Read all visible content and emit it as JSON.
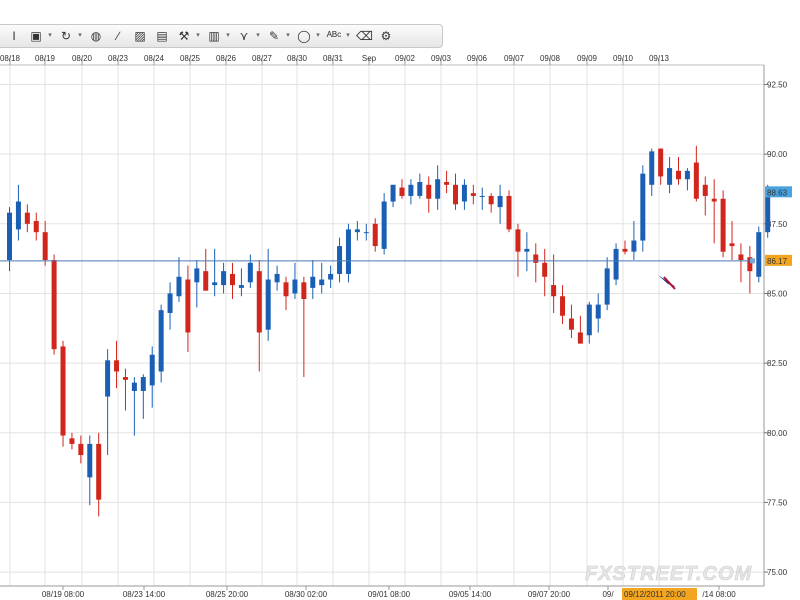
{
  "toolbar": {
    "icons": [
      {
        "name": "cursor-tool-icon",
        "glyph": "Ι",
        "dropdown": false
      },
      {
        "name": "chart-properties-icon",
        "glyph": "▣",
        "dropdown": true
      },
      {
        "name": "refresh-icon",
        "glyph": "↻",
        "dropdown": true
      },
      {
        "name": "globe-icon",
        "glyph": "◍",
        "dropdown": false
      },
      {
        "name": "ruler-icon",
        "glyph": "∕",
        "dropdown": false
      },
      {
        "name": "picture-icon",
        "glyph": "▨",
        "dropdown": false
      },
      {
        "name": "chart-type-icon",
        "glyph": "▤",
        "dropdown": false
      },
      {
        "name": "fibonacci-icon",
        "glyph": "⚒",
        "dropdown": true
      },
      {
        "name": "channel-icon",
        "glyph": "▥",
        "dropdown": true
      },
      {
        "name": "gann-icon",
        "glyph": "⋎",
        "dropdown": true
      },
      {
        "name": "pencil-icon",
        "glyph": "✎",
        "dropdown": true
      },
      {
        "name": "ellipse-icon",
        "glyph": "◯",
        "dropdown": true
      },
      {
        "name": "text-tool-icon",
        "glyph": "ᴬᴮᶜ",
        "dropdown": true
      },
      {
        "name": "eraser-icon",
        "glyph": "⌫",
        "dropdown": false
      },
      {
        "name": "settings-icon",
        "glyph": "⚙",
        "dropdown": false
      }
    ]
  },
  "chart_data": {
    "type": "candlestick",
    "top_date_labels": [
      "08/18",
      "08/19",
      "08/20",
      "08/23",
      "08/24",
      "08/25",
      "08/26",
      "08/27",
      "08/30",
      "08/31",
      "Sep",
      "09/02",
      "09/03",
      "09/06",
      "09/07",
      "09/08",
      "09/09",
      "09/10",
      "09/13"
    ],
    "bottom_time_labels": [
      "08/19 08:00",
      "08/23 14:00",
      "08/25 20:00",
      "08/30 02:00",
      "09/01 08:00",
      "09/05 14:00",
      "09/07 20:00",
      "09/",
      "09/12/2011 20:00",
      "/14 08:00"
    ],
    "y_ticks": [
      "92.50",
      "90.00",
      "87.50",
      "85.00",
      "82.50",
      "80.00",
      "77.50",
      "75.00"
    ],
    "ylim": [
      74.5,
      93.2
    ],
    "current_price": "86.17",
    "last_price": "88.63",
    "horizontal_line": 86.17,
    "cursor_time_label": "09/12/2011 20:00",
    "watermark": "FXSTREET.COM",
    "colors": {
      "up": "#1a5fb4",
      "down": "#d0261c",
      "price_line": "#4a78b5",
      "grid": "#e3e3e3",
      "current_bg": "#f3a51f",
      "last_bg": "#4aa3df"
    },
    "candles": [
      {
        "o": 86.2,
        "h": 88.1,
        "l": 85.8,
        "c": 87.9
      },
      {
        "o": 87.3,
        "h": 88.9,
        "l": 86.9,
        "c": 88.3
      },
      {
        "o": 87.9,
        "h": 88.2,
        "l": 87.2,
        "c": 87.5
      },
      {
        "o": 87.6,
        "h": 87.9,
        "l": 86.9,
        "c": 87.2
      },
      {
        "o": 87.2,
        "h": 87.6,
        "l": 86.0,
        "c": 86.2
      },
      {
        "o": 86.2,
        "h": 86.4,
        "l": 82.8,
        "c": 83.0
      },
      {
        "o": 83.1,
        "h": 83.3,
        "l": 79.5,
        "c": 79.9
      },
      {
        "o": 79.8,
        "h": 80.0,
        "l": 79.4,
        "c": 79.6
      },
      {
        "o": 79.6,
        "h": 79.9,
        "l": 78.9,
        "c": 79.2
      },
      {
        "o": 78.4,
        "h": 79.9,
        "l": 77.4,
        "c": 79.6
      },
      {
        "o": 79.6,
        "h": 80.0,
        "l": 77.0,
        "c": 77.6
      },
      {
        "o": 81.3,
        "h": 83.0,
        "l": 79.2,
        "c": 82.6
      },
      {
        "o": 82.6,
        "h": 83.3,
        "l": 81.6,
        "c": 82.2
      },
      {
        "o": 82.0,
        "h": 82.3,
        "l": 80.8,
        "c": 81.9
      },
      {
        "o": 81.5,
        "h": 82.0,
        "l": 79.9,
        "c": 81.8
      },
      {
        "o": 81.5,
        "h": 82.1,
        "l": 80.5,
        "c": 82.0
      },
      {
        "o": 81.7,
        "h": 83.1,
        "l": 80.9,
        "c": 82.8
      },
      {
        "o": 82.2,
        "h": 84.6,
        "l": 81.8,
        "c": 84.4
      },
      {
        "o": 84.3,
        "h": 85.4,
        "l": 83.7,
        "c": 85.0
      },
      {
        "o": 84.9,
        "h": 86.3,
        "l": 84.7,
        "c": 85.6
      },
      {
        "o": 85.5,
        "h": 86.0,
        "l": 82.9,
        "c": 83.6
      },
      {
        "o": 85.4,
        "h": 86.2,
        "l": 84.5,
        "c": 85.9
      },
      {
        "o": 85.8,
        "h": 86.6,
        "l": 85.3,
        "c": 85.1
      },
      {
        "o": 85.3,
        "h": 86.6,
        "l": 84.9,
        "c": 85.4
      },
      {
        "o": 85.3,
        "h": 86.1,
        "l": 85.0,
        "c": 85.8
      },
      {
        "o": 85.7,
        "h": 86.1,
        "l": 84.8,
        "c": 85.3
      },
      {
        "o": 85.2,
        "h": 85.9,
        "l": 84.9,
        "c": 85.3
      },
      {
        "o": 85.4,
        "h": 86.4,
        "l": 85.2,
        "c": 86.1
      },
      {
        "o": 85.8,
        "h": 86.2,
        "l": 82.2,
        "c": 83.6
      },
      {
        "o": 83.7,
        "h": 86.6,
        "l": 83.3,
        "c": 85.5
      },
      {
        "o": 85.4,
        "h": 86.0,
        "l": 85.1,
        "c": 85.7
      },
      {
        "o": 85.4,
        "h": 85.6,
        "l": 84.4,
        "c": 84.9
      },
      {
        "o": 85.0,
        "h": 86.1,
        "l": 84.8,
        "c": 85.5
      },
      {
        "o": 85.4,
        "h": 85.6,
        "l": 82.0,
        "c": 84.8
      },
      {
        "o": 85.2,
        "h": 86.2,
        "l": 84.8,
        "c": 85.6
      },
      {
        "o": 85.3,
        "h": 86.1,
        "l": 85.0,
        "c": 85.5
      },
      {
        "o": 85.5,
        "h": 86.0,
        "l": 85.2,
        "c": 85.7
      },
      {
        "o": 85.7,
        "h": 87.0,
        "l": 85.4,
        "c": 86.7
      },
      {
        "o": 85.7,
        "h": 87.5,
        "l": 85.4,
        "c": 87.3
      },
      {
        "o": 87.2,
        "h": 87.6,
        "l": 86.9,
        "c": 87.3
      },
      {
        "o": 87.2,
        "h": 87.5,
        "l": 86.9,
        "c": 87.2
      },
      {
        "o": 87.5,
        "h": 87.7,
        "l": 86.5,
        "c": 86.7
      },
      {
        "o": 86.6,
        "h": 88.6,
        "l": 86.4,
        "c": 88.3
      },
      {
        "o": 88.3,
        "h": 88.9,
        "l": 88.1,
        "c": 88.9
      },
      {
        "o": 88.8,
        "h": 89.1,
        "l": 88.4,
        "c": 88.5
      },
      {
        "o": 88.5,
        "h": 89.1,
        "l": 88.2,
        "c": 88.9
      },
      {
        "o": 88.5,
        "h": 89.3,
        "l": 88.4,
        "c": 89.0
      },
      {
        "o": 88.9,
        "h": 89.2,
        "l": 87.9,
        "c": 88.4
      },
      {
        "o": 88.4,
        "h": 89.6,
        "l": 88.0,
        "c": 89.1
      },
      {
        "o": 89.0,
        "h": 89.4,
        "l": 88.6,
        "c": 88.9
      },
      {
        "o": 88.9,
        "h": 89.3,
        "l": 88.0,
        "c": 88.2
      },
      {
        "o": 88.3,
        "h": 89.1,
        "l": 88.0,
        "c": 88.9
      },
      {
        "o": 88.6,
        "h": 88.9,
        "l": 88.2,
        "c": 88.5
      },
      {
        "o": 88.5,
        "h": 88.8,
        "l": 88.0,
        "c": 88.5
      },
      {
        "o": 88.5,
        "h": 88.6,
        "l": 87.9,
        "c": 88.2
      },
      {
        "o": 88.1,
        "h": 88.9,
        "l": 87.5,
        "c": 88.5
      },
      {
        "o": 88.5,
        "h": 88.7,
        "l": 87.2,
        "c": 87.3
      },
      {
        "o": 87.3,
        "h": 87.5,
        "l": 85.6,
        "c": 86.5
      },
      {
        "o": 86.5,
        "h": 87.2,
        "l": 85.8,
        "c": 86.6
      },
      {
        "o": 86.4,
        "h": 86.8,
        "l": 85.4,
        "c": 86.1
      },
      {
        "o": 86.1,
        "h": 86.6,
        "l": 84.9,
        "c": 85.6
      },
      {
        "o": 85.3,
        "h": 86.4,
        "l": 84.3,
        "c": 84.9
      },
      {
        "o": 84.9,
        "h": 85.3,
        "l": 83.9,
        "c": 84.2
      },
      {
        "o": 84.1,
        "h": 84.6,
        "l": 83.4,
        "c": 83.7
      },
      {
        "o": 83.6,
        "h": 84.2,
        "l": 83.2,
        "c": 83.2
      },
      {
        "o": 83.5,
        "h": 84.7,
        "l": 83.2,
        "c": 84.6
      },
      {
        "o": 84.1,
        "h": 85.0,
        "l": 83.6,
        "c": 84.6
      },
      {
        "o": 84.6,
        "h": 86.3,
        "l": 84.4,
        "c": 85.9
      },
      {
        "o": 85.5,
        "h": 86.8,
        "l": 85.3,
        "c": 86.6
      },
      {
        "o": 86.6,
        "h": 86.9,
        "l": 86.4,
        "c": 86.5
      },
      {
        "o": 86.5,
        "h": 87.6,
        "l": 86.2,
        "c": 86.9
      },
      {
        "o": 86.9,
        "h": 89.6,
        "l": 86.5,
        "c": 89.3
      },
      {
        "o": 88.9,
        "h": 90.2,
        "l": 88.5,
        "c": 90.1
      },
      {
        "o": 90.2,
        "h": 90.2,
        "l": 88.9,
        "c": 89.2
      },
      {
        "o": 88.9,
        "h": 89.9,
        "l": 88.6,
        "c": 89.5
      },
      {
        "o": 89.4,
        "h": 89.9,
        "l": 88.9,
        "c": 89.1
      },
      {
        "o": 89.1,
        "h": 89.5,
        "l": 88.7,
        "c": 89.4
      },
      {
        "o": 89.7,
        "h": 90.3,
        "l": 88.3,
        "c": 88.4
      },
      {
        "o": 88.9,
        "h": 89.2,
        "l": 87.8,
        "c": 88.5
      },
      {
        "o": 88.4,
        "h": 89.1,
        "l": 86.8,
        "c": 88.3
      },
      {
        "o": 88.4,
        "h": 88.7,
        "l": 86.3,
        "c": 86.5
      },
      {
        "o": 86.8,
        "h": 87.6,
        "l": 86.2,
        "c": 86.7
      },
      {
        "o": 86.4,
        "h": 86.8,
        "l": 85.4,
        "c": 86.2
      },
      {
        "o": 86.3,
        "h": 86.7,
        "l": 85.0,
        "c": 85.8
      },
      {
        "o": 85.6,
        "h": 87.4,
        "l": 85.4,
        "c": 87.2
      },
      {
        "o": 87.2,
        "h": 88.9,
        "l": 87.0,
        "c": 88.6
      }
    ]
  }
}
